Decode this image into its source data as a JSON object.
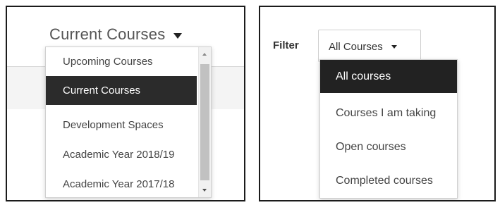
{
  "left_panel": {
    "select_value": "Current Courses",
    "options": [
      {
        "label": "Upcoming Courses",
        "selected": false
      },
      {
        "label": "Current Courses",
        "selected": true
      },
      {
        "label": "Development Spaces",
        "selected": false
      },
      {
        "label": "Academic Year 2018/19",
        "selected": false
      },
      {
        "label": "Academic Year 2017/18",
        "selected": false
      }
    ]
  },
  "right_panel": {
    "filter_label": "Filter",
    "select_value": "All Courses",
    "options": [
      {
        "label": "All courses",
        "selected": true
      },
      {
        "label": "Courses I am taking",
        "selected": false
      },
      {
        "label": "Open courses",
        "selected": false
      },
      {
        "label": "Completed courses",
        "selected": false
      }
    ]
  },
  "icons": {
    "dropdown": "caret-down-icon",
    "scroll_up": "scroll-up-arrow-icon",
    "scroll_down": "scroll-down-arrow-icon"
  },
  "colors": {
    "selected_background": "#2b2b2b",
    "selected_text": "#ffffff",
    "panel_border": "#1b1b1b"
  }
}
